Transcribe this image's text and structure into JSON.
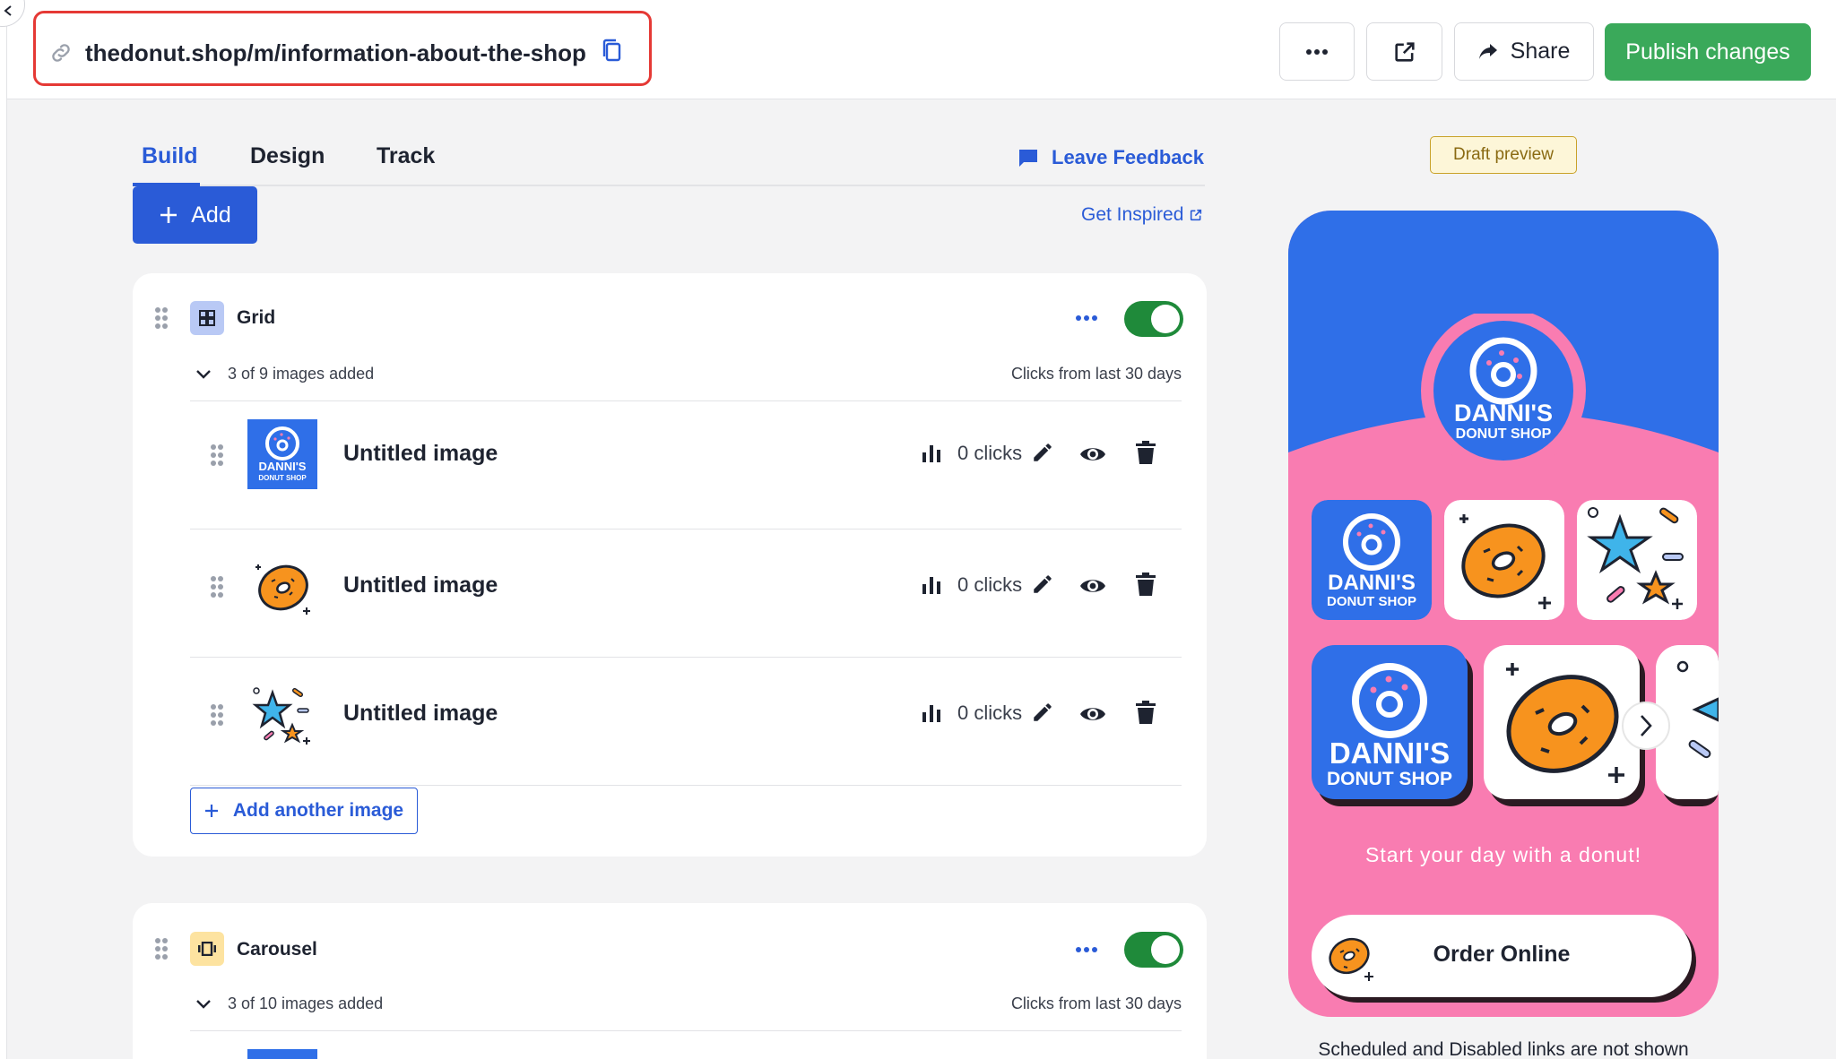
{
  "header": {
    "url": "thedonut.shop/m/information-about-the-shop",
    "share_label": "Share",
    "publish_label": "Publish changes"
  },
  "tabs": [
    {
      "label": "Build",
      "active": true
    },
    {
      "label": "Design",
      "active": false
    },
    {
      "label": "Track",
      "active": false
    }
  ],
  "toolbar": {
    "feedback_label": "Leave Feedback",
    "add_label": "Add",
    "inspired_label": "Get Inspired"
  },
  "grid_block": {
    "title": "Grid",
    "enabled": true,
    "count_text": "3 of 9 images added",
    "clicks_caption": "Clicks from last 30 days",
    "items": [
      {
        "title": "Untitled image",
        "clicks": "0 clicks",
        "thumb": "dannis-donut-shop-logo"
      },
      {
        "title": "Untitled image",
        "clicks": "0 clicks",
        "thumb": "donut-icon"
      },
      {
        "title": "Untitled image",
        "clicks": "0 clicks",
        "thumb": "stars-sprinkles-icon"
      }
    ],
    "add_another_label": "Add another image"
  },
  "carousel_block": {
    "title": "Carousel",
    "enabled": true,
    "count_text": "3 of 10 images added",
    "clicks_caption": "Clicks from last 30 days"
  },
  "preview": {
    "badge": "Draft preview",
    "logo_line1": "DANNI'S",
    "logo_line2": "DONUT SHOP",
    "tagline": "Start your day with a donut!",
    "order_label": "Order Online",
    "footer_note": "Scheduled and Disabled links are not shown"
  },
  "colors": {
    "accent": "#2a5bd7",
    "publish": "#3aa95a",
    "toggle_on": "#1f8a3a",
    "phone_blue": "#2f6fe8",
    "phone_pink": "#f97cb1",
    "highlight": "#e53935"
  }
}
